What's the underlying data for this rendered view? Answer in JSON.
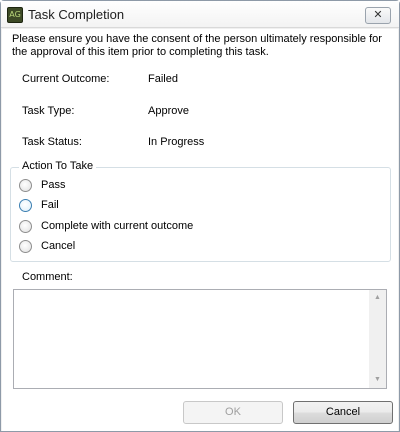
{
  "window": {
    "title": "Task Completion",
    "icon_name": "app-logo-icon",
    "close_glyph": "✕"
  },
  "consent_message": "Please ensure you have the consent of the person ultimately responsible for the approval of this item prior to completing this task.",
  "details": [
    {
      "label": "Current Outcome:",
      "value": "Failed"
    },
    {
      "label": "Task Type:",
      "value": "Approve"
    },
    {
      "label": "Task Status:",
      "value": "In Progress"
    }
  ],
  "action_group": {
    "legend": "Action To Take",
    "options": [
      {
        "label": "Pass",
        "selected": false
      },
      {
        "label": "Fail",
        "selected": false,
        "focused": true
      },
      {
        "label": "Complete with current outcome",
        "selected": false
      },
      {
        "label": "Cancel",
        "selected": false
      }
    ]
  },
  "comment": {
    "label": "Comment:",
    "value": ""
  },
  "buttons": {
    "ok_label": "OK",
    "ok_enabled": false,
    "cancel_label": "Cancel"
  },
  "colors": {
    "accent_focus": "#3c7fb1",
    "disabled_text": "#a0a0a0"
  }
}
